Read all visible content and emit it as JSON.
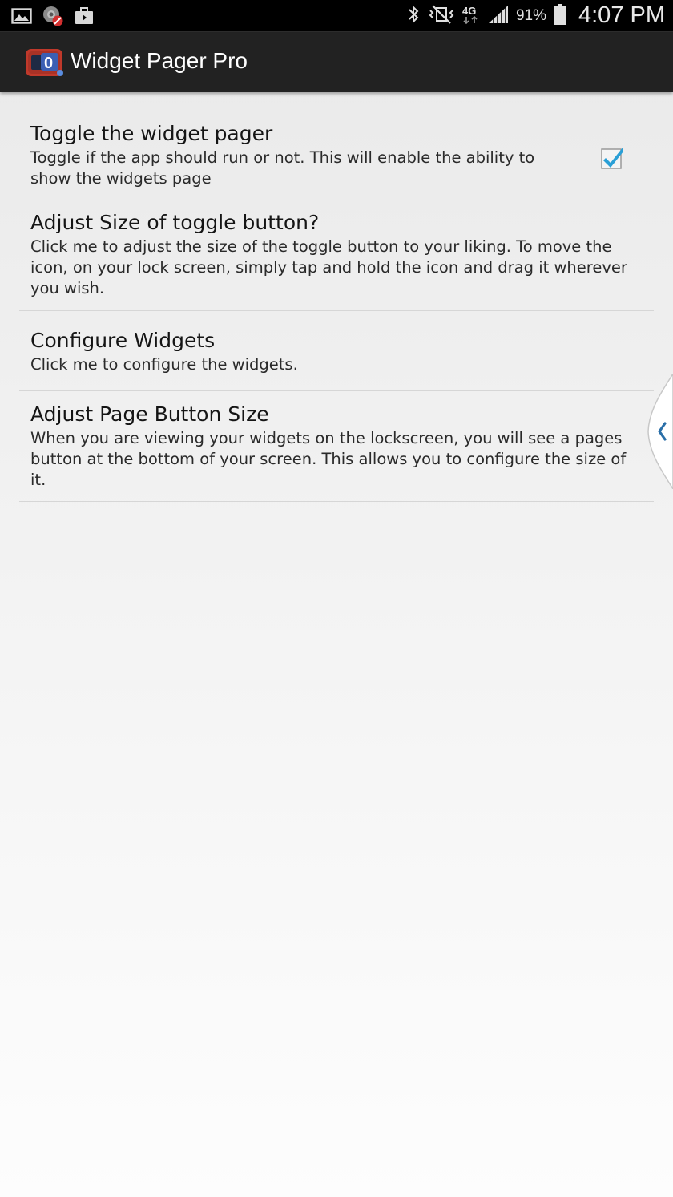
{
  "status_bar": {
    "battery_percent": "91%",
    "time": "4:07 PM",
    "left_icons": [
      "gallery-icon",
      "blocked-app-icon",
      "briefcase-icon"
    ],
    "right_icons": [
      "bluetooth-icon",
      "vibrate-mute-icon",
      "4g-data-icon",
      "signal-icon",
      "battery-icon"
    ]
  },
  "action_bar": {
    "title": "Widget Pager Pro"
  },
  "preferences": [
    {
      "title": "Toggle the widget pager",
      "summary": "Toggle if the app should run or not. This will enable the ability to show the widgets page",
      "checked": true
    },
    {
      "title": "Adjust Size of toggle button?",
      "summary": "Click me to adjust the size of the toggle button to your liking. To move the icon, on your lock screen, simply tap and hold the icon and drag it wherever you wish."
    },
    {
      "title": "Configure Widgets",
      "summary": "Click me to configure the widgets."
    },
    {
      "title": "Adjust Page Button Size",
      "summary": "When you are viewing your widgets on the lockscreen, you will see a pages button at the bottom of your screen. This allows you to configure the size of it."
    }
  ],
  "colors": {
    "status_bar_bg": "#000000",
    "action_bar_bg": "#222222",
    "checkbox_accent": "#2a9fd6",
    "edge_handle_accent": "#2a6fa8"
  }
}
